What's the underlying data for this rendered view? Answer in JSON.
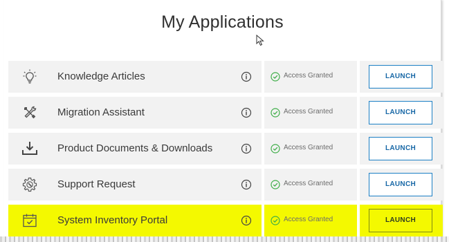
{
  "page": {
    "title": "My Applications"
  },
  "apps": [
    {
      "name": "Knowledge Articles",
      "icon": "lightbulb-icon",
      "access": "Access Granted",
      "launch": "LAUNCH"
    },
    {
      "name": "Migration Assistant",
      "icon": "tools-icon",
      "access": "Access Granted",
      "launch": "LAUNCH"
    },
    {
      "name": "Product Documents & Downloads",
      "icon": "download-tray-icon",
      "access": "Access Granted",
      "launch": "LAUNCH"
    },
    {
      "name": "Support Request",
      "icon": "gear-wrench-icon",
      "access": "Access Granted",
      "launch": "LAUNCH"
    },
    {
      "name": "System Inventory Portal",
      "icon": "calendar-check-icon",
      "access": "Access Granted",
      "launch": "LAUNCH",
      "highlighted": true
    }
  ],
  "colors": {
    "row_background": "#f2f2f2",
    "highlight": "#f4f900",
    "launch_border": "#1b7fc4",
    "check_green": "#3fae49",
    "title_text": "#303030"
  }
}
